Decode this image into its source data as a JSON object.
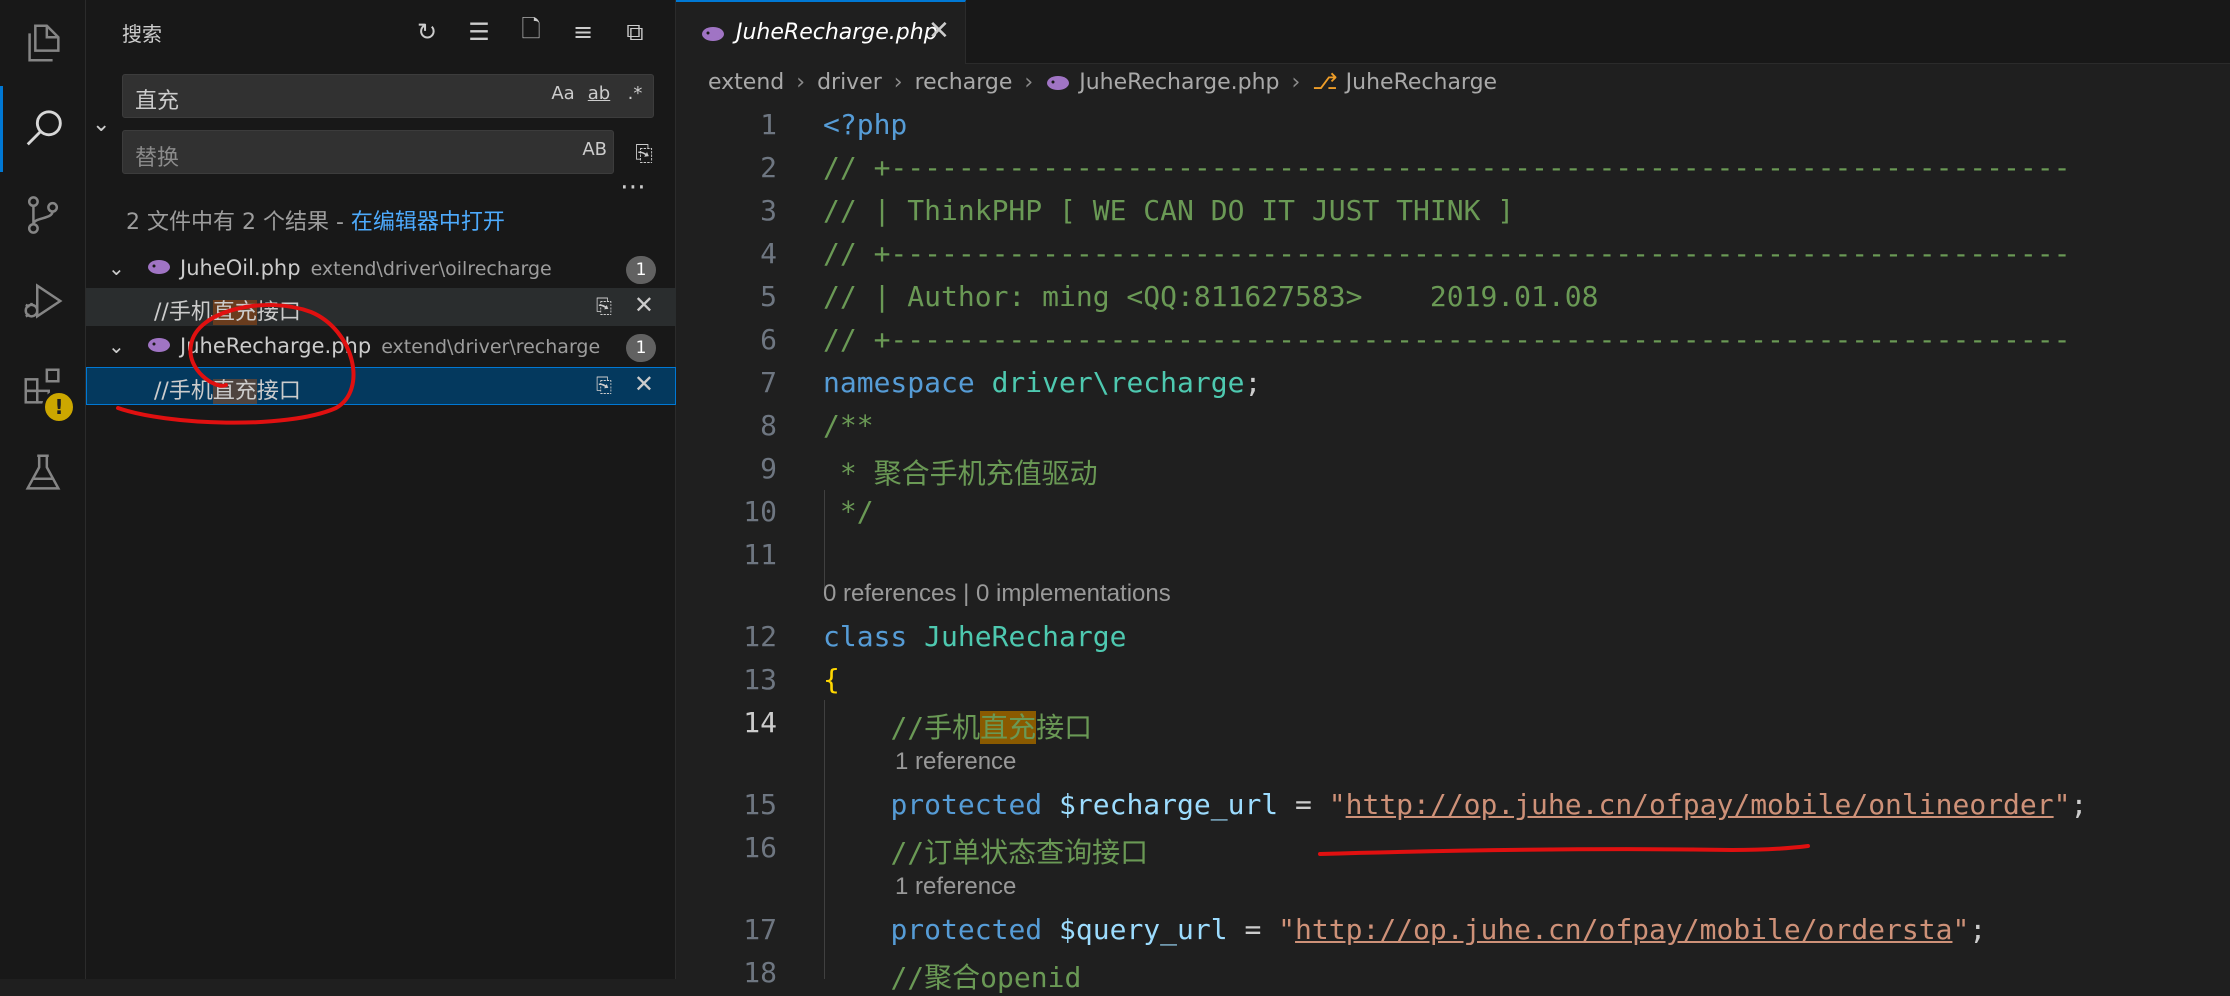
{
  "activity_bar": {
    "items": [
      {
        "name": "explorer-icon",
        "active": false
      },
      {
        "name": "search-icon",
        "active": true
      },
      {
        "name": "source-control-icon",
        "active": false
      },
      {
        "name": "run-debug-icon",
        "active": false
      },
      {
        "name": "extensions-icon",
        "active": false,
        "badge": "warning"
      },
      {
        "name": "testing-icon",
        "active": false
      }
    ]
  },
  "sidebar": {
    "title": "搜索",
    "actions": [
      "refresh-icon",
      "clear-results-icon",
      "new-search-editor-icon",
      "view-as-tree-icon",
      "collapse-all-icon"
    ],
    "search_value": "直充",
    "search_options": {
      "match_case": "Aa",
      "whole_word": "ab",
      "regex": ".*"
    },
    "replace_placeholder": "替换",
    "replace_option": "AB",
    "summary": "2 文件中有 2 个结果 - ",
    "open_in_editor": "在编辑器中打开",
    "results": [
      {
        "file": "JuheOil.php",
        "path": "extend\\driver\\oilrecharge",
        "count": "1",
        "match": {
          "before": "//手机",
          "hit": "直充",
          "after": "接口"
        }
      },
      {
        "file": "JuheRecharge.php",
        "path": "extend\\driver\\recharge",
        "count": "1",
        "match": {
          "before": "//手机",
          "hit": "直充",
          "after": "接口"
        }
      }
    ]
  },
  "editor": {
    "tab_label": "JuheRecharge.php",
    "breadcrumbs": [
      "extend",
      "driver",
      "recharge",
      "JuheRecharge.php",
      "JuheRecharge"
    ],
    "line_numbers": [
      "1",
      "2",
      "3",
      "4",
      "5",
      "6",
      "7",
      "8",
      "9",
      "10",
      "11",
      "12",
      "13",
      "14",
      "15",
      "16",
      "17",
      "18"
    ],
    "lines": {
      "l1": "<?php",
      "l2": "// +----------------------------------------------------------------------",
      "l3": "// | ThinkPHP [ WE CAN DO IT JUST THINK ]",
      "l4": "// +----------------------------------------------------------------------",
      "l5": "// | Author: ming <QQ:811627583>    2019.01.08",
      "l6": "// +----------------------------------------------------------------------",
      "l7_kw": "namespace",
      "l7_ns": "driver\\recharge",
      "l7_end": ";",
      "l8": "/**",
      "l9": " * 聚合手机充值驱动",
      "l10": " */",
      "lens_class": "0 references | 0 implementations",
      "l12_kw": "class",
      "l12_name": "JuheRecharge",
      "l13": "{",
      "l14_before": "//手机",
      "l14_hit": "直充",
      "l14_after": "接口",
      "lens_15": "1 reference",
      "l15_kw": "protected",
      "l15_var": "$recharge_url",
      "l15_eq": " = ",
      "l15_url": "http://op.juhe.cn/ofpay/mobile/onlineorder",
      "l16": "//订单状态查询接口",
      "lens_17": "1 reference",
      "l17_kw": "protected",
      "l17_var": "$query_url",
      "l17_eq": " = ",
      "l17_url": "http://op.juhe.cn/ofpay/mobile/ordersta",
      "l18": "//聚合openid"
    }
  },
  "colors": {
    "accent": "#0078d4",
    "annotation_red": "#e01010",
    "selection_bg": "#04395e"
  }
}
